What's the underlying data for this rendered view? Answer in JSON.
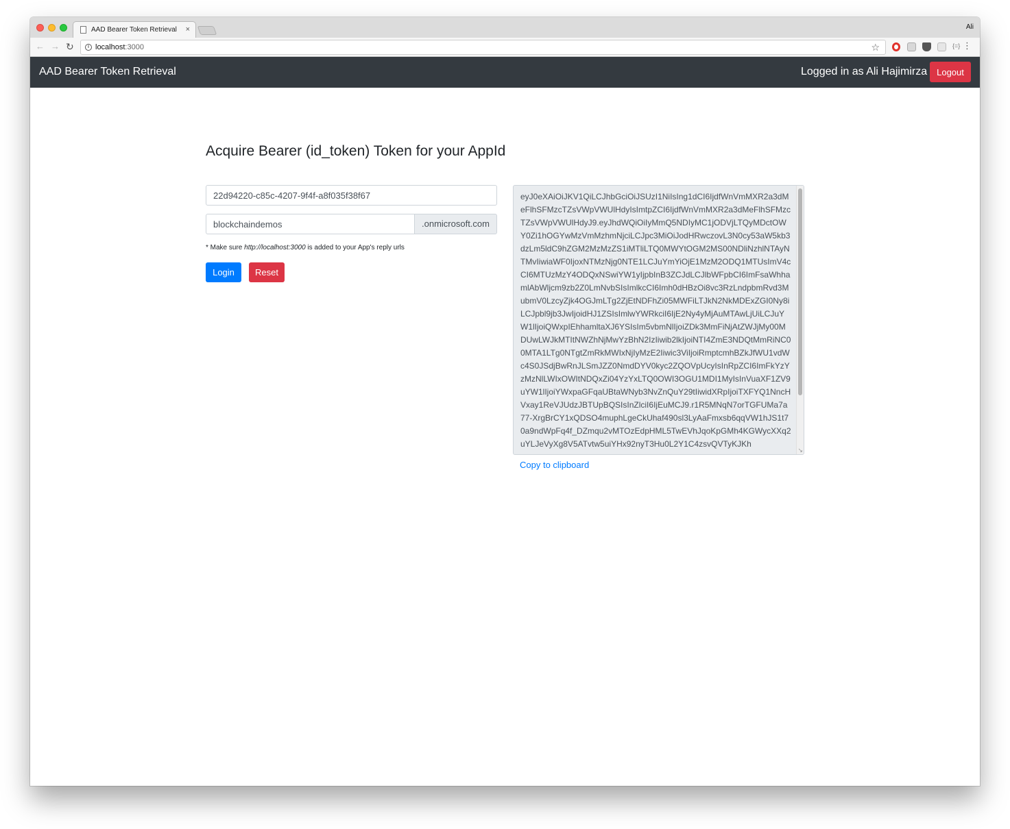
{
  "browser": {
    "tab_title": "AAD Bearer Token Retrieval",
    "tab_close": "×",
    "profile_name": "Ali",
    "url_host": "localhost",
    "url_port": ":3000"
  },
  "navbar": {
    "brand": "AAD Bearer Token Retrieval",
    "logged_in_text": "Logged in as Ali Hajimirza",
    "logout_label": "Logout",
    "colors": {
      "background": "#343a40",
      "logout": "#dc3545"
    }
  },
  "main": {
    "title": "Acquire Bearer (id_token) Token for your AppId",
    "app_id_value": "22d94220-c85c-4207-9f4f-a8f035f38f67",
    "tenant_value": "blockchaindemos",
    "tenant_suffix": ".onmicrosoft.com",
    "note_prefix": "* Make sure ",
    "note_url": "http://localhost:3000",
    "note_suffix": " is added to your App's reply urls",
    "login_label": "Login",
    "reset_label": "Reset",
    "token_value": "eyJ0eXAiOiJKV1QiLCJhbGciOiJSUzI1NiIsIng1dCI6IjdfWnVmMXR2a3dMeFlhSFMzcTZsVWpVWUlHdyIsImtpZCI6IjdfWnVmMXR2a3dMeFlhSFMzcTZsVWpVWUlHdyJ9.eyJhdWQiOiIyMmQ5NDIyMC1jODVjLTQyMDctOWY0Zi1hOGYwMzVmMzhmNjciLCJpc3MiOiJodHRwczovL3N0cy53aW5kb3dzLm5ldC9hZGM2MzMzZS1iMTliLTQ0MWYtOGM2MS00NDliNzhlNTAyNTMvIiwiaWF0IjoxNTMzNjg0NTE1LCJuYmYiOjE1MzM2ODQ1MTUsImV4cCI6MTUzMzY4ODQxNSwiYW1yIjpbInB3ZCJdLCJlbWFpbCI6ImFsaWhhamlAbWljcm9zb2Z0LmNvbSIsImlkcCI6Imh0dHBzOi8vc3RzLndpbmRvd3MubmV0LzcyZjk4OGJmLTg2ZjEtNDFhZi05MWFiLTJkN2NkMDExZGI0Ny8iLCJpbl9jb3JwIjoidHJ1ZSIsImlwYWRkciI6IjE2Ny4yMjAuMTAwLjUiLCJuYW1lIjoiQWxpIEhhamltaXJ6YSIsIm5vbmNlIjoiZDk3MmFiNjAtZWJjMy00MDUwLWJkMTItNWZhNjMwYzBhN2IzIiwib2lkIjoiNTI4ZmE3NDQtMmRiNC00MTA1LTg0NTgtZmRkMWIxNjIyMzE2Iiwic3ViIjoiRmptcmhBZkJfWU1vdWc4S0JSdjBwRnJLSmJZZ0NmdDYV0kyc2ZQOVpUcyIsInRpZCI6ImFkYzYzMzNlLWIxOWItNDQxZi04YzYxLTQ0OWI3OGU1MDI1MyIsInVuaXF1ZV9uYW1lIjoiYWxpaGFqaUBtaWNyb3NvZnQuY29tIiwidXRpIjoiTXFYQ1NncHVxay1ReVJUdzJBTUpBQSIsInZlciI6IjEuMCJ9.r1R5MNqN7orTGFUMa7a77-XrgBrCY1xQDSO4muphLgeCkUhaf490sl3LyAaFmxsb6qqVW1hJS1t70a9ndWpFq4f_DZmqu2vMTOzEdpHML5TwEVhJqoKpGMh4KGWycXXq2uYLJeVyXg8V5ATvtw5uiYHx92nyT3Hu0L2Y1C4zsvQVTyKJKh",
    "copy_label": "Copy to clipboard"
  }
}
